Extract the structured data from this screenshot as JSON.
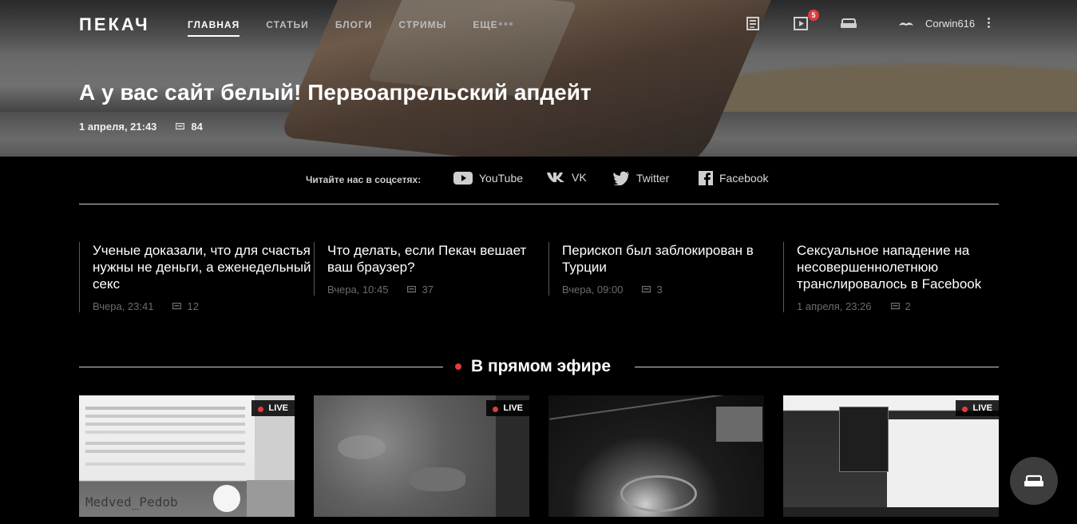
{
  "header": {
    "logo": "ПЕКАЧ",
    "nav": [
      {
        "label": "ГЛАВНАЯ",
        "active": true
      },
      {
        "label": "СТАТЬИ",
        "active": false
      },
      {
        "label": "БЛОГИ",
        "active": false
      },
      {
        "label": "СТРИМЫ",
        "active": false
      },
      {
        "label": "ЕЩЕ",
        "active": false
      }
    ],
    "more_dots": "•••",
    "icons": [
      "news-feed-icon",
      "video-icon",
      "sofa-icon"
    ],
    "video_badge": "5",
    "username": "Corwin616"
  },
  "hero": {
    "title": "А у вас сайт белый! Первоапрельский апдейт",
    "date": "1 апреля, 21:43",
    "comments": "84"
  },
  "social": {
    "label": "Читайте нас в соцсетях:",
    "links": [
      {
        "name": "YouTube",
        "icon": "youtube-icon"
      },
      {
        "name": "VK",
        "icon": "vk-icon"
      },
      {
        "name": "Twitter",
        "icon": "twitter-icon"
      },
      {
        "name": "Facebook",
        "icon": "facebook-icon"
      }
    ]
  },
  "news": [
    {
      "title": "Ученые доказали, что для счастья нужны не деньги, а еженедельный секс",
      "date": "Вчера, 23:41",
      "comments": "12"
    },
    {
      "title": "Что делать, если Пекач вешает ваш браузер?",
      "date": "Вчера, 10:45",
      "comments": "37"
    },
    {
      "title": "Перископ был заблокирован в Турции",
      "date": "Вчера, 09:00",
      "comments": "3"
    },
    {
      "title": "Сексуальное нападение на несовершеннолетнюю транслировалось в Facebook",
      "date": "1 апреля, 23:26",
      "comments": "2"
    }
  ],
  "live": {
    "title": "В прямом эфире",
    "tag": "LIVE",
    "streams": [
      {
        "kind": "code-editor-stream",
        "overlay_text": "Medved_Pedob"
      },
      {
        "kind": "strategy-game-stream"
      },
      {
        "kind": "space-game-stream"
      },
      {
        "kind": "browser-stream"
      }
    ]
  },
  "colors": {
    "accent": "#e23b3b",
    "background": "#000000",
    "muted": "#6c6c6c"
  }
}
